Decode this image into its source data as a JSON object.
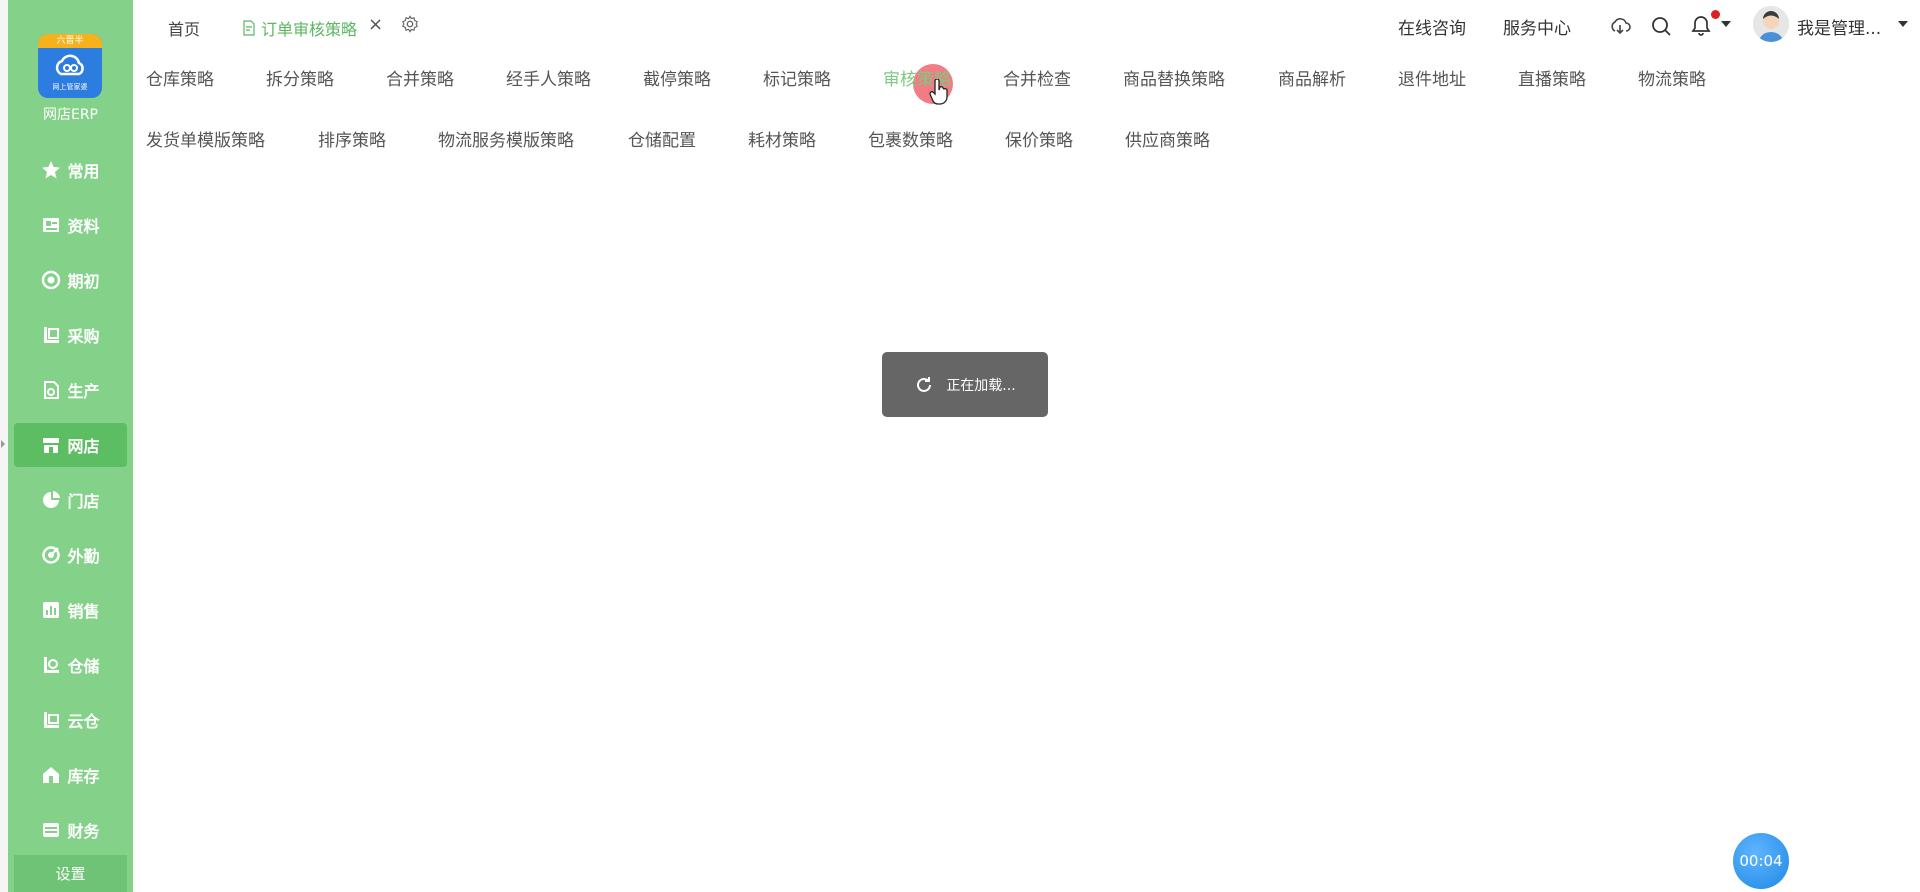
{
  "app": {
    "logo_ribbon": "六晋半",
    "logo_caption": "网上管家婆",
    "logo_text": "网店ERP"
  },
  "sidebar": {
    "items": [
      {
        "label": "常用",
        "icon": "star-icon"
      },
      {
        "label": "资料",
        "icon": "profile-card-icon"
      },
      {
        "label": "期初",
        "icon": "target-icon"
      },
      {
        "label": "采购",
        "icon": "purchase-icon"
      },
      {
        "label": "生产",
        "icon": "production-icon"
      },
      {
        "label": "网店",
        "icon": "store-icon",
        "active": true
      },
      {
        "label": "门店",
        "icon": "pie-icon"
      },
      {
        "label": "外勤",
        "icon": "field-work-icon"
      },
      {
        "label": "销售",
        "icon": "bar-chart-icon"
      },
      {
        "label": "仓储",
        "icon": "warehouse-icon"
      },
      {
        "label": "云仓",
        "icon": "cloud-warehouse-icon"
      },
      {
        "label": "库存",
        "icon": "house-icon"
      },
      {
        "label": "财务",
        "icon": "finance-icon"
      }
    ],
    "settings_label": "设置"
  },
  "tabs": {
    "home": "首页",
    "active": "订单审核策略",
    "close_glyph": "×"
  },
  "header": {
    "consult": "在线咨询",
    "service": "服务中心",
    "username": "我是管理..."
  },
  "strategies": {
    "row1": [
      "仓库策略",
      "拆分策略",
      "合并策略",
      "经手人策略",
      "截停策略",
      "标记策略",
      "审核策略",
      "合并检查",
      "商品替换策略",
      "商品解析",
      "退件地址",
      "直播策略",
      "物流策略"
    ],
    "row2": [
      "发货单模版策略",
      "排序策略",
      "物流服务模版策略",
      "仓储配置",
      "耗材策略",
      "包裹数策略",
      "保价策略",
      "供应商策略"
    ],
    "active": "审核策略"
  },
  "loading": {
    "text": "正在加载..."
  },
  "timer": {
    "text": "00:04"
  },
  "colors": {
    "sidebar_bg": "#84d18a",
    "active_green": "#59b761",
    "loading_bg": "#666666",
    "timer_blue": "#1e88e5"
  }
}
